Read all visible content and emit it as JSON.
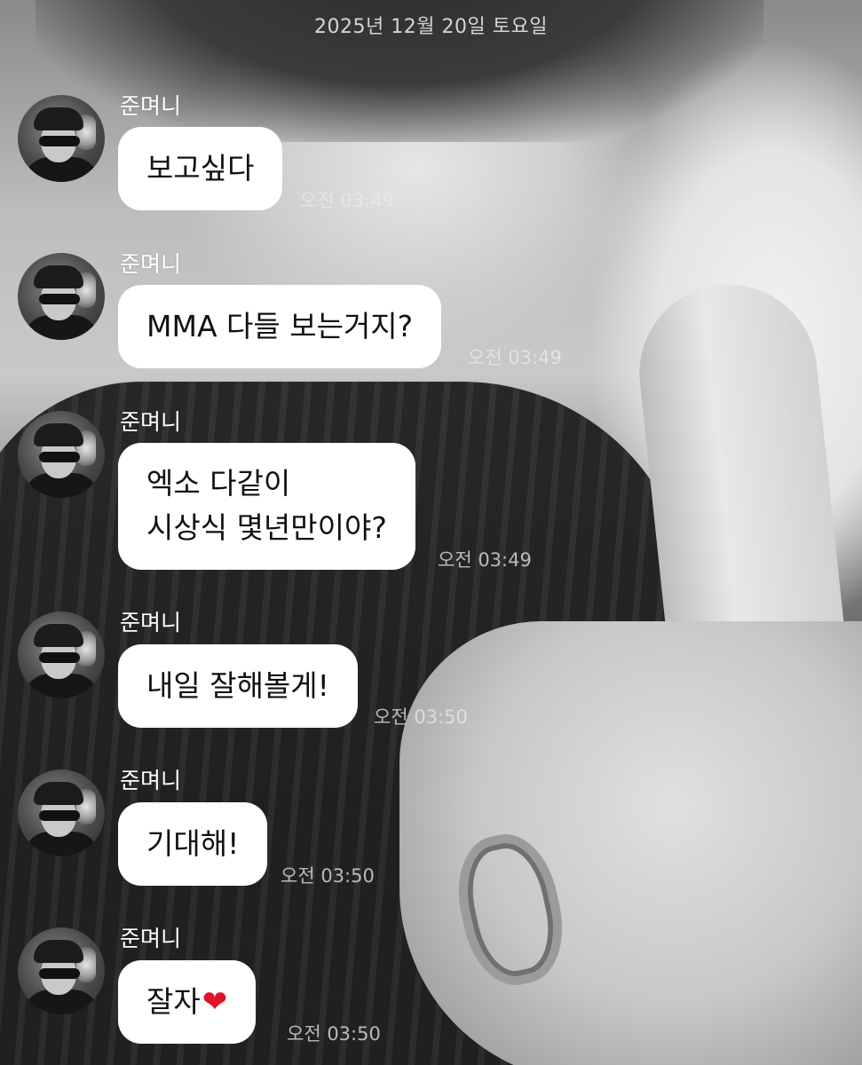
{
  "date_header": "2025년 12월 20일 토요일",
  "messages": [
    {
      "sender": "준며니",
      "lines": [
        "보고싶다"
      ],
      "time": "오전 03:49"
    },
    {
      "sender": "준며니",
      "lines": [
        "MMA 다들 보는거지?"
      ],
      "time": "오전 03:49"
    },
    {
      "sender": "준며니",
      "lines": [
        "엑소 다같이",
        "시상식 몇년만이야?"
      ],
      "time": "오전 03:49"
    },
    {
      "sender": "준며니",
      "lines": [
        "내일 잘해볼게!"
      ],
      "time": "오전 03:50"
    },
    {
      "sender": "준며니",
      "lines": [
        "기대해!"
      ],
      "time": "오전 03:50"
    },
    {
      "sender": "준며니",
      "lines": [
        "잘자"
      ],
      "emoji": "❤",
      "time": "오전 03:50"
    }
  ]
}
